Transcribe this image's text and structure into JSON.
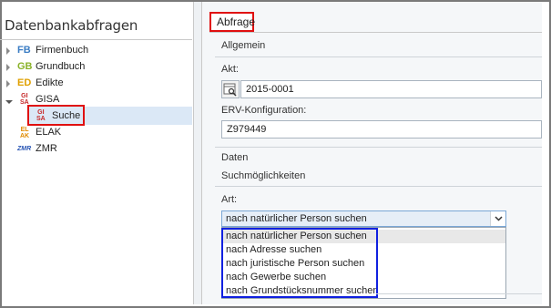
{
  "left_panel": {
    "title": "Datenbankabfragen",
    "items": [
      {
        "badge": "FB",
        "label": "Firmenbuch"
      },
      {
        "badge": "GB",
        "label": "Grundbuch"
      },
      {
        "badge": "ED",
        "label": "Edikte"
      },
      {
        "badge_top": "GI",
        "badge_bottom": "SA",
        "label": "GISA",
        "expanded": true,
        "children": [
          {
            "badge_top": "GI",
            "badge_bottom": "SA",
            "label": "Suche",
            "selected": true
          }
        ]
      },
      {
        "badge_top": "EL",
        "badge_bottom": "AK",
        "label": "ELAK"
      },
      {
        "badge": "ZMR",
        "label": "ZMR"
      }
    ]
  },
  "tab": {
    "label": "Abfrage"
  },
  "allgemein": {
    "section_label": "Allgemein",
    "akt_label": "Akt:",
    "akt_value": "2015-0001",
    "erv_label": "ERV-Konfiguration:",
    "erv_value": "Z979449"
  },
  "daten": {
    "section_label": "Daten",
    "sub_label": "Suchmöglichkeiten",
    "art_label": "Art:",
    "art_selected": "nach natürlicher Person suchen",
    "options": [
      "nach natürlicher Person suchen",
      "nach Adresse suchen",
      "nach juristische Person suchen",
      "nach Gewerbe suchen",
      "nach Grundstücksnummer suchen"
    ]
  },
  "colors": {
    "highlight_red": "#e01010",
    "highlight_blue": "#1020e0",
    "selection": "#dbe8f6"
  }
}
